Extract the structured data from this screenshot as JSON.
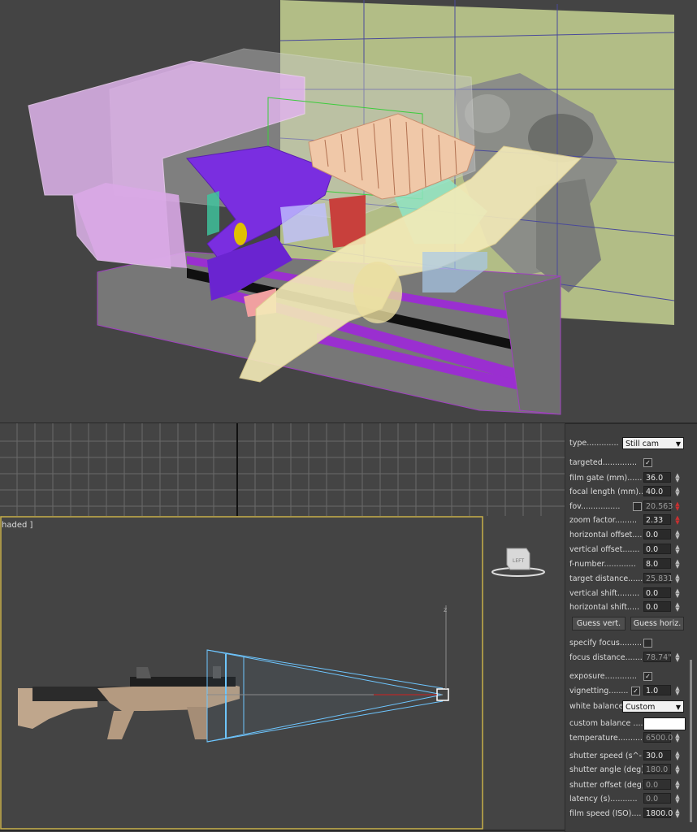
{
  "viewport_bottom": {
    "label": "haded ]"
  },
  "viewcube": {
    "label": "LEFT"
  },
  "axis": {
    "z": "z"
  },
  "camera": {
    "type_label": "type.............",
    "type_value": "Still cam",
    "targeted_label": "targeted..............",
    "targeted_checked": "✓",
    "film_gate_label": "film gate (mm).......",
    "film_gate_value": "36.0",
    "focal_length_label": "focal length (mm)...",
    "focal_length_value": "40.0",
    "fov_label": "fov................",
    "fov_value": "20.563",
    "zoom_factor_label": "zoom factor.........",
    "zoom_factor_value": "2.33",
    "horizontal_offset_label": "horizontal offset....",
    "horizontal_offset_value": "0.0",
    "vertical_offset_label": "vertical offset.......",
    "vertical_offset_value": "0.0",
    "f_number_label": "f-number.............",
    "f_number_value": "8.0",
    "target_distance_label": "target distance......",
    "target_distance_value": "25.831",
    "vertical_shift_label": "vertical shift.........",
    "vertical_shift_value": "0.0",
    "horizontal_shift_label": "horizontal shift.....",
    "horizontal_shift_value": "0.0",
    "guess_vert_label": "Guess vert.",
    "guess_horiz_label": "Guess horiz.",
    "specify_focus_label": "specify focus.........",
    "focus_distance_label": "focus distance.......",
    "focus_distance_value": "78.74\"",
    "exposure_label": "exposure.............",
    "exposure_checked": "✓",
    "vignetting_label": "vignetting........",
    "vignetting_checked": "✓",
    "vignetting_value": "1.0",
    "white_balance_label": "white balance",
    "white_balance_value": "Custom",
    "custom_balance_label": "custom balance .....",
    "temperature_label": "temperature..........",
    "temperature_value": "6500.0",
    "shutter_speed_label": "shutter speed (s^-1",
    "shutter_speed_value": "30.0",
    "shutter_angle_label": "shutter angle (deg).",
    "shutter_angle_value": "180.0",
    "shutter_offset_label": "shutter offset (deg)",
    "shutter_offset_value": "0.0",
    "latency_label": "latency (s)...........",
    "latency_value": "0.0",
    "film_speed_label": "film speed (ISO)....",
    "film_speed_value": "1800.0"
  },
  "colors": {
    "viewport_bg": "#444444",
    "panel_bg": "#3e3e3e",
    "selection_yellow": "#c8b04a",
    "frustum_blue": "#6ec6ff"
  }
}
